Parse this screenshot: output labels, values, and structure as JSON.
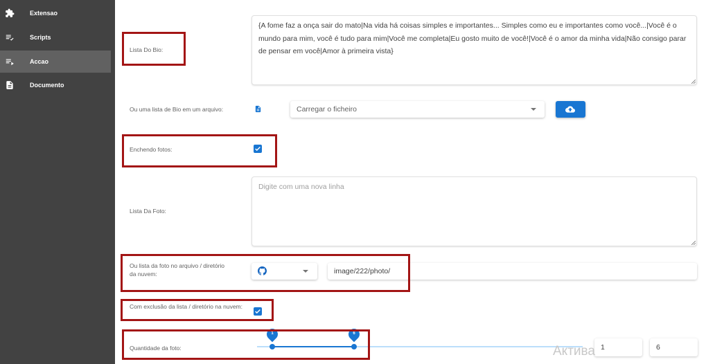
{
  "sidebar": {
    "items": [
      {
        "label": "Extensao",
        "icon": "puzzle-icon"
      },
      {
        "label": "Scripts",
        "icon": "playlist-check-icon"
      },
      {
        "label": "Accao",
        "icon": "playlist-play-icon",
        "active": true
      },
      {
        "label": "Documento",
        "icon": "document-icon"
      }
    ]
  },
  "form": {
    "bio_list_label": "Lista Do Bio:",
    "bio_list_value": "{A fome faz a onça sair do mato|Na vida há coisas simples e importantes... Simples como eu e importantes como você...|Você é o mundo para mim, você é tudo para mim|Você me completa|Eu gosto muito de você!|Você é o amor da minha vida|Não consigo parar de pensar em você|Amor à primeira vista}",
    "bio_file_label": "Ou uma lista de Bio em um arquivo:",
    "bio_file_select": "Carregar o ficheiro",
    "fill_photos_label": "Enchendo fotos:",
    "fill_photos_checked": true,
    "photo_list_label": "Lista Da Foto:",
    "photo_list_placeholder": "Digite com uma nova linha",
    "photo_cloud_label": "Ou lista da foto no arquivo / diretório da nuvem:",
    "photo_cloud_provider_icon": "github-icon",
    "photo_cloud_path": "image/222/photo/",
    "exclude_label": "Com exclusão da lista / diretório na nuvem:",
    "exclude_checked": true,
    "quantity_label": "Quantidade da foto:",
    "quantity_min": 1,
    "quantity_max": 6,
    "quantity_min_text": "1",
    "quantity_max_text": "6"
  },
  "watermark": "Актива",
  "colors": {
    "sidebar_bg": "#424242",
    "sidebar_active": "#616161",
    "accent": "#1976d2",
    "highlight_box": "#a31515"
  }
}
